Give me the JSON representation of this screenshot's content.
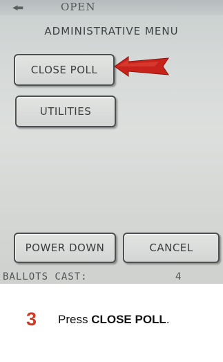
{
  "status_bar": {
    "status": "OPEN",
    "battery_icon": "battery-icon"
  },
  "menu": {
    "title": "ADMINISTRATIVE MENU",
    "close_poll_label": "CLOSE POLL",
    "utilities_label": "UTILITIES",
    "power_down_label": "POWER DOWN",
    "cancel_label": "CANCEL"
  },
  "footer": {
    "ballots_label": "BALLOTS CAST:",
    "ballots_value": "4"
  },
  "instruction": {
    "step_number": "3",
    "text_prefix": "Press",
    "text_bold": "CLOSE POLL",
    "text_suffix": "."
  },
  "annotation": {
    "arrow_icon": "red-arrow-icon",
    "arrow_color": "#c8231b"
  }
}
